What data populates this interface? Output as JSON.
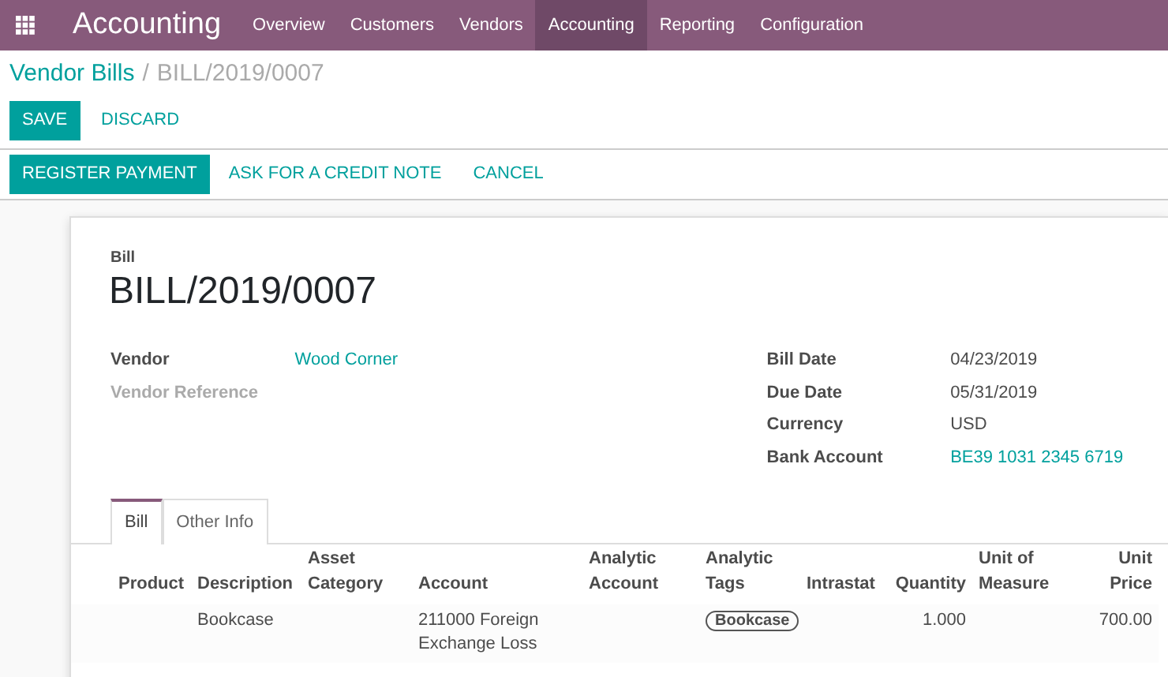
{
  "app_title": "Accounting",
  "menu": [
    {
      "label": "Overview",
      "selected": false
    },
    {
      "label": "Customers",
      "selected": false
    },
    {
      "label": "Vendors",
      "selected": false
    },
    {
      "label": "Accounting",
      "selected": true
    },
    {
      "label": "Reporting",
      "selected": false
    },
    {
      "label": "Configuration",
      "selected": false
    }
  ],
  "breadcrumb": {
    "parent": "Vendor Bills",
    "separator": "/",
    "current": "BILL/2019/0007"
  },
  "form_buttons": [
    {
      "label": "SAVE",
      "kind": "primary"
    },
    {
      "label": "DISCARD",
      "kind": "link"
    }
  ],
  "action_buttons": [
    {
      "label": "REGISTER PAYMENT",
      "kind": "primary"
    },
    {
      "label": "ASK FOR A CREDIT NOTE",
      "kind": "link"
    },
    {
      "label": "CANCEL",
      "kind": "link"
    }
  ],
  "sheet": {
    "type_label": "Bill",
    "number": "BILL/2019/0007",
    "left_fields": [
      {
        "label": "Vendor",
        "value": "Wood Corner",
        "kind": "link",
        "disabled": false
      },
      {
        "label": "Vendor Reference",
        "disabled": true
      }
    ],
    "right_fields": [
      {
        "label": "Bill Date",
        "value": "04/23/2019",
        "kind": "text",
        "disabled": false
      },
      {
        "label": "Due Date",
        "value": "05/31/2019",
        "kind": "text",
        "disabled": false
      },
      {
        "label": "Currency",
        "value": "USD",
        "kind": "text",
        "disabled": false
      },
      {
        "label": "Bank Account",
        "value": "BE39 1031 2345 6719",
        "kind": "link",
        "disabled": false
      }
    ],
    "tabs": [
      {
        "label": "Bill",
        "selected": true
      },
      {
        "label": "Other Info",
        "selected": false
      }
    ],
    "table": {
      "columns": [
        {
          "label": "Product"
        },
        {
          "label": "Description"
        },
        {
          "label": "Asset Category"
        },
        {
          "label": "Account"
        },
        {
          "label": "Analytic Account"
        },
        {
          "label": "Analytic Tags"
        },
        {
          "label": "Intrastat"
        },
        {
          "label": "Quantity"
        },
        {
          "label": "Unit of Measure"
        },
        {
          "label": "Unit Price"
        }
      ],
      "rows": [
        {
          "cells": [
            null,
            {
              "text": "Bookcase"
            },
            null,
            {
              "text": "211000 Foreign Exchange Loss"
            },
            null,
            {
              "text": "Bookcase",
              "kind": "tag"
            },
            null,
            {
              "text": "1.000"
            },
            null,
            {
              "text": "700.00"
            }
          ]
        }
      ]
    }
  }
}
